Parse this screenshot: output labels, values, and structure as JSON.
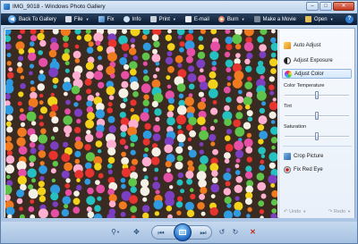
{
  "window": {
    "title": "IMG_9018 - Windows Photo Gallery"
  },
  "toolbar": {
    "back_label": "Back To Gallery",
    "file_label": "File",
    "fix_label": "Fix",
    "info_label": "Info",
    "print_label": "Print",
    "email_label": "E-mail",
    "burn_label": "Burn",
    "movie_label": "Make a Movie",
    "open_label": "Open",
    "help_label": "?"
  },
  "fix_panel": {
    "auto_adjust": "Auto Adjust",
    "adjust_exposure": "Adjust Exposure",
    "adjust_color": "Adjust Color",
    "color_temperature_label": "Color Temperature",
    "tint_label": "Tint",
    "saturation_label": "Saturation",
    "color_temperature_value": 0.5,
    "tint_value": 0.5,
    "saturation_value": 0.5,
    "crop_picture": "Crop Picture",
    "fix_red_eye": "Fix Red Eye",
    "undo_label": "Undo",
    "redo_label": "Redo"
  },
  "controls": {
    "zoom_icon": "magnifier-icon",
    "fit_icon": "actual-size-icon",
    "prev_icon": "previous-icon",
    "slideshow_icon": "slideshow-icon",
    "next_icon": "next-icon",
    "rotate_left_icon": "rotate-counterclockwise-icon",
    "rotate_right_icon": "rotate-clockwise-icon",
    "delete_icon": "delete-icon"
  },
  "photo": {
    "subject_icon": "photo-beaded-curtain"
  },
  "colors": {
    "toolbar": "#0c1c33",
    "accent": "#1d65c4",
    "delete": "#c62a1d"
  }
}
